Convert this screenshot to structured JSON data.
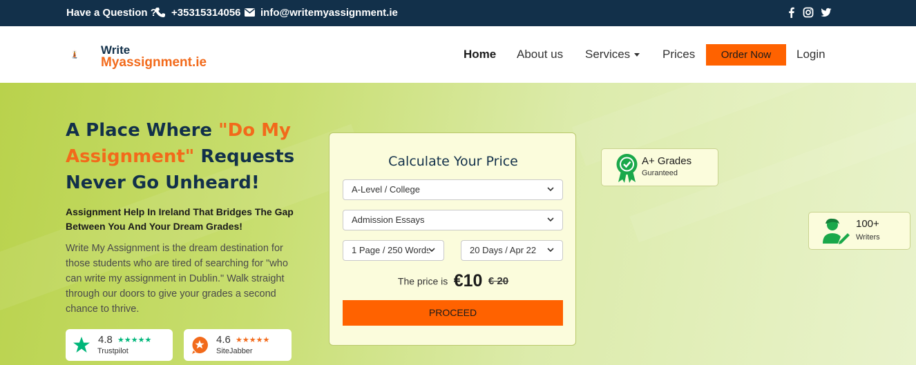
{
  "topbar": {
    "question": "Have a Question ?",
    "phone": "+35315314056",
    "email": "info@writemyassignment.ie"
  },
  "logo": {
    "word1": "Write",
    "word2": "Myassignment.ie"
  },
  "nav": {
    "home": "Home",
    "about": "About us",
    "services": "Services",
    "prices": "Prices",
    "order": "Order Now",
    "login": "Login"
  },
  "hero": {
    "heading_part1": "A Place Where ",
    "heading_accent": "\"Do My Assignment\"",
    "heading_part2": " Requests Never Go Unheard!",
    "subheading": "Assignment Help In Ireland That Bridges The Gap Between You And Your Dream Grades!",
    "paragraph": "Write My Assignment is the dream destination for those students who are tired of searching for \"who can write my assignment in Dublin.\" Walk straight through our doors to give your grades a second chance to thrive."
  },
  "ratings": [
    {
      "score": "4.8",
      "stars": "★★★★★",
      "source": "Trustpilot"
    },
    {
      "score": "4.6",
      "stars": "★★★★★",
      "source": "SiteJabber"
    }
  ],
  "calculator": {
    "title": "Calculate Your Price",
    "level": "A-Level / College",
    "paper_type": "Admission Essays",
    "pages": "1 Page / 250 Words",
    "deadline": "20 Days / Apr 22",
    "price_label": "The price is",
    "price_now": "€10",
    "price_old": "€ 20",
    "proceed": "PROCEED"
  },
  "badges": {
    "grades_title": "A+ Grades",
    "grades_sub": "Guranteed",
    "writers_title": "100+",
    "writers_sub": "Writers"
  },
  "colors": {
    "navy": "#12304a",
    "orange": "#ff6200",
    "brand_orange": "#f26a1b",
    "trustpilot_green": "#00b67a",
    "sitejabber_orange": "#f26a1b",
    "badge_green": "#1aa84a"
  }
}
